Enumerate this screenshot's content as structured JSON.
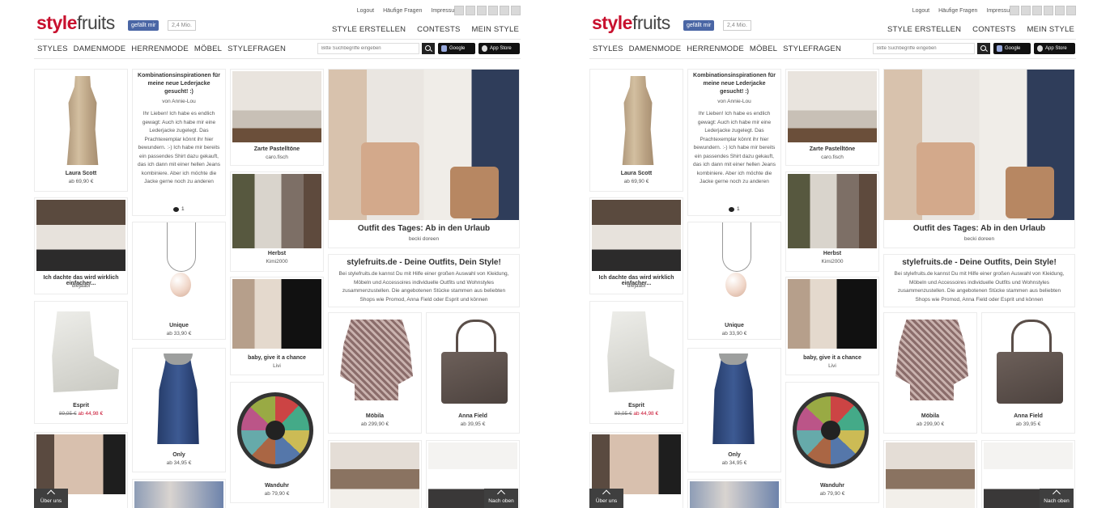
{
  "header": {
    "logo_part1": "style",
    "logo_part2": "fruits",
    "fb_like": "gefällt mir",
    "fb_count": "2,4 Mio.",
    "top_links": [
      "Logout",
      "Häufige Fragen",
      "Impressum"
    ],
    "main_links": [
      "STYLE ERSTELLEN",
      "CONTESTS",
      "MEIN STYLE"
    ]
  },
  "nav": {
    "items": [
      "STYLES",
      "DAMENMODE",
      "HERRENMODE",
      "MÖBEL",
      "STYLEFRAGEN"
    ],
    "search_placeholder": "Bitte Suchbegriffe eingeben",
    "google_play": "Google play",
    "app_store": "App Store"
  },
  "cards": {
    "dress": {
      "title": "Laura Scott",
      "price": "ab 69,90 €"
    },
    "question": {
      "heading": "Kombinationsinspirationen für meine neue Lederjacke gesucht! :)",
      "author": "von Annie-Lou",
      "body": "Ihr Lieben! Ich habe es endlich gewagt: Auch ich habe mir eine Lederjacke zugelegt. Das Prachtexemplar könnt ihr hier bewundern. :-) Ich habe mir bereits ein passendes Shirt dazu gekauft, das ich dann mit einer hellen Jeans kombiniere. Aber ich möchte die Jacke gerne noch zu anderen",
      "comments": "1"
    },
    "living": {
      "title": "Zarte Pastelltöne",
      "author": "caro.fisch"
    },
    "hero": {
      "title": "Outfit des Tages: Ab in den Urlaub",
      "author": "becki doreen"
    },
    "bedroom": {
      "title": "Ich dachte das wird wirklich einfacher...",
      "author": "diejaabi"
    },
    "herbst": {
      "title": "Herbst",
      "author": "Kimi2000"
    },
    "about": {
      "title": "stylefruits.de - Deine Outfits, Dein Style!",
      "body": "Bei stylefruits.de kannst Du mit Hilfe einer großen Auswahl von Kleidung, Möbeln und Accessoires individuelle Outfits und Wohnstyles zusammenzustellen. Die angebotenen Stücke stammen aus beliebten Shops wie Promod, Anna Field oder Esprit und können"
    },
    "necklace": {
      "title": "Unique",
      "price": "ab 33,90 €"
    },
    "boots": {
      "title": "Esprit",
      "old_price": "89,95 €",
      "sale_price": "ab 44,98 €"
    },
    "baby": {
      "title": "baby, give it a chance",
      "author": "Livi"
    },
    "chair": {
      "title": "Möbila",
      "price": "ab 299,90 €"
    },
    "bag": {
      "title": "Anna Field",
      "price": "ab 39,95 €"
    },
    "top": {
      "title": "Only",
      "price": "ab 34,95 €"
    },
    "clock": {
      "title": "Wanduhr",
      "price": "ab 79,90 €"
    }
  },
  "footer": {
    "ueber_uns": "Über uns",
    "nach_oben": "Nach oben"
  }
}
